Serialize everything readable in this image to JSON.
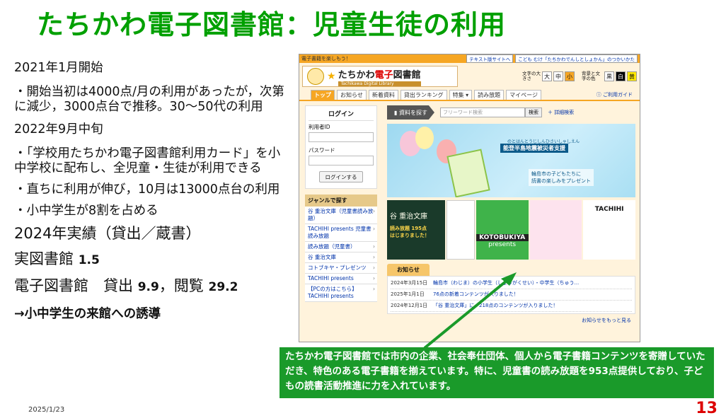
{
  "slide": {
    "title": "たちかわ電子図書館：児童生徒の利用",
    "date": "2025/1/23",
    "page": "13"
  },
  "left": {
    "l1": "2021年1月開始",
    "l2": "・開始当初は4000点/月の利用があったが，次第に減少，3000点台で推移。30～50代の利用",
    "l3": "2022年9月中旬",
    "l4": "・「学校用たちかわ電子図書館利用カード」を小中学校に配布し、全児童・生徒が利用できる",
    "l5": "・直ちに利用が伸び，10月は13000点台の利用",
    "l6": "・小中学生が8割を占める",
    "l7": "2024年実績（貸出／蔵書）",
    "l8a": "実図書館 ",
    "l8b": "1.5",
    "l9a": "電子図書館　貸出 ",
    "l9b": "9.9",
    "l9c": "，閲覧 ",
    "l9d": "29.2",
    "l10": "→小中学生の来館への誘導"
  },
  "site": {
    "topbar_text": "電子書籍を楽しもう！",
    "text_site": "テキスト版サイトへ",
    "kids_site": "こども むけ「たちかわでんしとしょかん」のつかいかた",
    "logo_name_a": "たちかわ",
    "logo_name_b": "電子",
    "logo_name_c": "図書館",
    "logo_sub": "Tachikawa Digital Library",
    "size_label": "文字の大きさ",
    "sizes": [
      "大",
      "中",
      "小"
    ],
    "color_label": "背景と文字の色",
    "colors": [
      "黒",
      "白",
      "黄"
    ],
    "guide": "ご利用ガイド",
    "nav": [
      "トップ",
      "お知らせ",
      "新着資料",
      "貸出ランキング",
      "特集 ▾",
      "読み放題",
      "マイページ"
    ],
    "login": {
      "title": "ログイン",
      "user_label": "利用者ID",
      "pass_label": "パスワード",
      "button": "ログインする"
    },
    "genre_title": "ジャンルで探す",
    "genres": [
      "谷 重治文庫（児童書読み放題）",
      "TACHIHI presents 児童書読み放題",
      "読み放題（児童書）",
      "谷 重治文庫",
      "コトブキヤ・プレゼンツ",
      "TACHIHI presents",
      "【PCの方はこちら】TACHIHI presents"
    ],
    "search_tag": "資料を探す",
    "search_placeholder": "フリーワード検索",
    "search_button": "検索",
    "advanced": "詳細検索",
    "banner_line1": "のとはんとうじしんひさいしゃしえん",
    "banner_line2": "能登半島地震被災者支援",
    "banner_line3": "輪島市の子どもたちに",
    "banner_line4": "読書の楽しみをプレゼント",
    "tile1a": "谷 重治文庫",
    "tile1b": "読み放題 195点",
    "tile1c": "はじまりました！",
    "tile3a": "KOTOBUKIYA",
    "tile3b": "presents",
    "tile5": "TACHIHI",
    "news_title": "お知らせ",
    "news": [
      {
        "date": "2024年3月15日",
        "text": "輪島市（わじま）の小学生（しょうがくせい）・中学生（ちゅう..."
      },
      {
        "date": "2025年1月1日",
        "text": "76点の新着コンテンツが入りました！"
      },
      {
        "date": "2024年12月1日",
        "text": "「谷 重治文庫」に、218点のコンテンツが入りました！"
      }
    ],
    "more": "お知らせをもっと見る"
  },
  "callout": "たちかわ電子図書館では市内の企業、社会奉仕団体、個人から電子書籍コンテンツを寄贈していただき、特色のある電子書籍を揃えています。特に、児童書の読み放題を953点提供しており、子どもの読書活動推進に力を入れています。",
  "colors": {
    "title_green": "#00a000",
    "callout_green": "#1a9a2a",
    "accent_orange": "#f6a623",
    "page_red": "#dd0000"
  }
}
